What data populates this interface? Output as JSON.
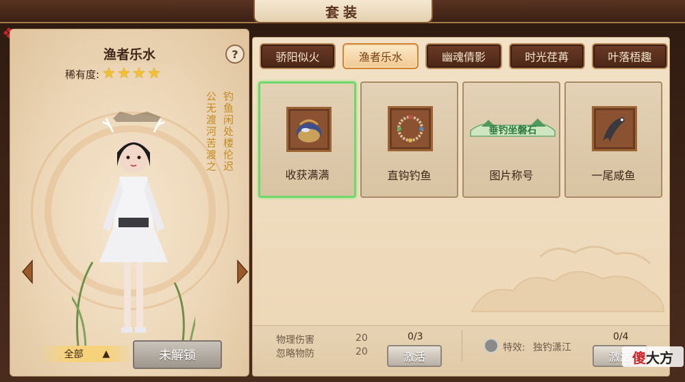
{
  "window": {
    "title": "套装"
  },
  "left": {
    "set_name": "渔者乐水",
    "help_label": "?",
    "rarity_label": "稀有度:",
    "rarity_stars": 4,
    "poem_lines": [
      "钓鱼闲处楼伦迟",
      "公无渡河苦渡之"
    ],
    "filter_label": "全部",
    "filter_arrow": "▲",
    "lock_button": "未解锁"
  },
  "tabs": [
    {
      "label": "骄阳似火",
      "active": false
    },
    {
      "label": "渔者乐水",
      "active": true
    },
    {
      "label": "幽魂倩影",
      "active": false
    },
    {
      "label": "时光荏苒",
      "active": false
    },
    {
      "label": "叶落梧趣",
      "active": false
    }
  ],
  "cards": [
    {
      "label": "收获满满",
      "icon": "fishing-basket-icon",
      "selected": true
    },
    {
      "label": "直钩钓鱼",
      "icon": "fishing-hook-ring-icon",
      "selected": false
    },
    {
      "label": "图片称号",
      "icon": "title-banner-icon",
      "banner_text": "垂钓坐磐石",
      "selected": false
    },
    {
      "label": "一尾咸鱼",
      "icon": "dried-fish-icon",
      "selected": false
    }
  ],
  "bottom": {
    "stats": [
      {
        "name": "物理伤害",
        "value": "20"
      },
      {
        "name": "忽略物防",
        "value": "20"
      }
    ],
    "progress_1": "0/3",
    "activate_1": "激活",
    "effect_label": "特效:",
    "effect_name": "独钓潇江",
    "progress_2": "0/4",
    "activate_2": "激活"
  },
  "watermark": {
    "part1": "傻",
    "part2": "大方"
  },
  "colors": {
    "tab_active": "#f0c992",
    "tab_inactive": "#5a2f1d",
    "selected_border": "#6ed96a",
    "star": "#f5c12a"
  }
}
